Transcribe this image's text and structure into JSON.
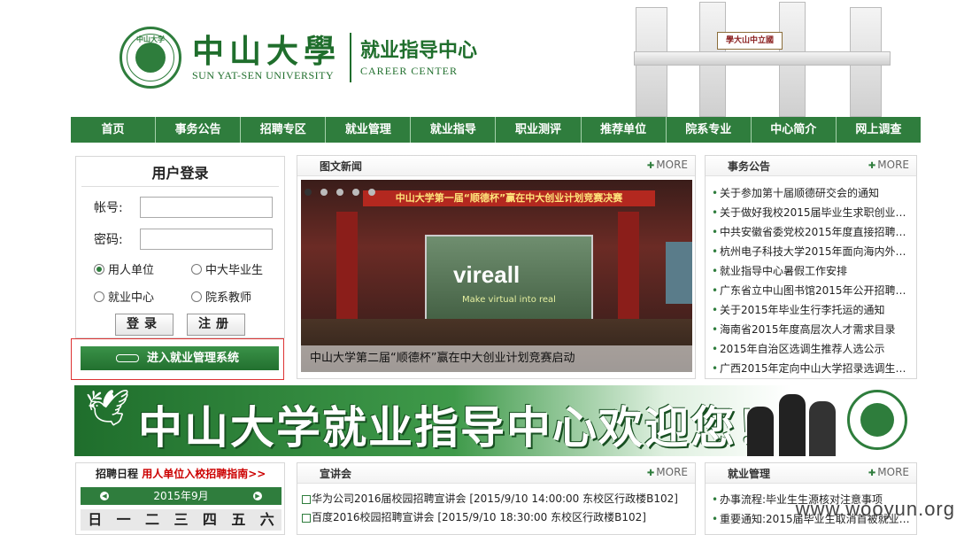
{
  "header": {
    "uni_cn": "中山大學",
    "uni_en": "SUN YAT-SEN UNIVERSITY",
    "center_cn": "就业指导中心",
    "center_en": "CAREER   CENTER",
    "gate_plaque": "學大山中立國",
    "seal_text": "中山大学"
  },
  "nav": [
    "首页",
    "事务公告",
    "招聘专区",
    "就业管理",
    "就业指导",
    "职业测评",
    "推荐单位",
    "院系专业",
    "中心简介",
    "网上调查"
  ],
  "login": {
    "title": "用户登录",
    "account_label": "帐号:",
    "password_label": "密码:",
    "roles": [
      "用人单位",
      "中大毕业生",
      "就业中心",
      "院系教师"
    ],
    "login_btn": "登录",
    "register_btn": "注册",
    "enter_btn": "进入就业管理系统"
  },
  "photo_news": {
    "title": "图文新闻",
    "more": "MORE",
    "banner": "中山大学第一届“顺德杯”赢在中大创业计划竞赛决赛",
    "screen_logo": "vireall",
    "screen_sub": "Make virtual into real",
    "caption": "中山大学第二届“顺德杯”赢在中大创业计划竞赛启动"
  },
  "notices": {
    "title": "事务公告",
    "more": "MORE",
    "items": [
      "关于参加第十届顺德研交会的通知",
      "关于做好我校2015届毕业生求职创业…",
      "中共安徽省委党校2015年度直接招聘…",
      "杭州电子科技大学2015年面向海内外…",
      "就业指导中心暑假工作安排",
      "广东省立中山图书馆2015年公开招聘…",
      "关于2015年毕业生行李托运的通知",
      "海南省2015年度高层次人才需求目录",
      "2015年自治区选调生推荐人选公示",
      "广西2015年定向中山大学招录选调生…"
    ]
  },
  "welcome": {
    "text": "中山大学就业指导中心欢迎您！"
  },
  "calendar": {
    "title": "招聘日程",
    "link": "用人单位入校招聘指南>>",
    "month": "2015年9月",
    "weekdays": [
      "日",
      "一",
      "二",
      "三",
      "四",
      "五",
      "六"
    ]
  },
  "talks": {
    "title": "宣讲会",
    "more": "MORE",
    "items": [
      "华为公司2016届校园招聘宣讲会 [2015/9/10 14:00:00 东校区行政楼B102]",
      "百度2016校园招聘宣讲会 [2015/9/10 18:30:00 东校区行政楼B102]"
    ]
  },
  "employment": {
    "title": "就业管理",
    "more": "MORE",
    "items": [
      "办事流程:毕业生生源核对注意事项",
      "重要通知:2015届毕业生取消首被就业…"
    ]
  },
  "watermark": "www.wooyun.org"
}
